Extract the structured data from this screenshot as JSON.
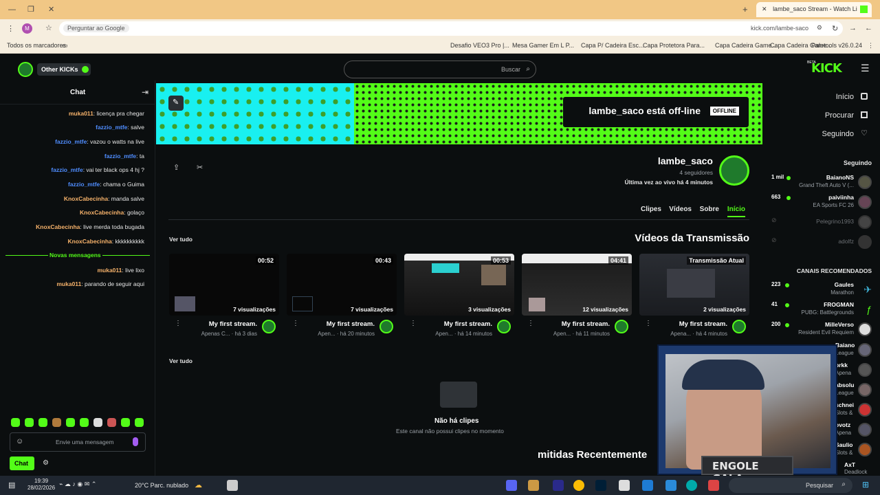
{
  "browser": {
    "tab_title": "lambe_saco Stream - Watch Li",
    "url": "kick.com/lambe-saco",
    "ask_google": "Perguntar ao Google",
    "all_bookmarks": "Todos os marcadores",
    "bookmarks": [
      "Paletools v26.0.24",
      "Capa Cadeira Game...",
      "Capa Cadeira Game...",
      "Capa Protetora Para...",
      "Capa P/ Cadeira Esc...",
      "Mesa Gamer Em L P...",
      "Desafio VEO3 Pro |..."
    ],
    "profile_initial": "M"
  },
  "header": {
    "logo": "KICK",
    "logo_badge": "BETA",
    "search_placeholder": "Buscar",
    "other_kicks": "Other KICKs"
  },
  "nav": {
    "items": [
      "Início",
      "Procurar",
      "Seguindo"
    ]
  },
  "following": {
    "title": "Seguindo",
    "channels": [
      {
        "name": "BaianoNS",
        "game": "Grand Theft Auto V (...",
        "viewers": "1 mil",
        "live": true
      },
      {
        "name": "paiviinha",
        "game": "EA Sports FC 26",
        "viewers": "663",
        "live": true
      },
      {
        "name": "Pelegrino1993",
        "game": "",
        "viewers": "",
        "live": false
      },
      {
        "name": "adolfz",
        "game": "",
        "viewers": "",
        "live": false
      }
    ]
  },
  "recommended": {
    "title": "CANAIS RECOMENDADOS",
    "channels": [
      {
        "name": "Gaules",
        "game": "Marathon",
        "viewers": "223"
      },
      {
        "name": "FROGMAN",
        "game": "PUBG: Battlegrounds",
        "viewers": "41"
      },
      {
        "name": "MilleVerso",
        "game": "Resident Evil Requiem",
        "viewers": "200"
      },
      {
        "name": "Baiano",
        "game": "League",
        "viewers": ""
      },
      {
        "name": "brkk",
        "game": "Apena",
        "viewers": ""
      },
      {
        "name": "absolu",
        "game": "League",
        "viewers": ""
      },
      {
        "name": "schnei",
        "game": "Slots &",
        "viewers": ""
      },
      {
        "name": "ovotz",
        "game": "Apena",
        "viewers": ""
      },
      {
        "name": "Saulio",
        "game": "Slots &",
        "viewers": ""
      },
      {
        "name": "AxT",
        "game": "Deadlock",
        "viewers": ""
      }
    ]
  },
  "banner": {
    "offline_badge": "OFFLINE",
    "offline_text": "lambe_saco está off-line"
  },
  "channel": {
    "name": "lambe_saco",
    "followers": "4 seguidores",
    "last_live": "Última vez ao vivo há 4 minutos",
    "tabs": [
      "Início",
      "Sobre",
      "Vídeos",
      "Clipes"
    ]
  },
  "videos": {
    "section_title": "Vídeos da Transmissão",
    "see_all": "Ver tudo",
    "items": [
      {
        "badge": "Transmissão Atual",
        "views": "2 visualizações",
        "title": "My first stream.",
        "meta": "Apena... · há 4 minutos"
      },
      {
        "badge": "04:41",
        "views": "12 visualizações",
        "title": "My first stream.",
        "meta": "Apen... · há 11 minutos"
      },
      {
        "badge": "00:53",
        "views": "3 visualizações",
        "title": "My first stream.",
        "meta": "Apen... · há 14 minutos"
      },
      {
        "badge": "00:43",
        "views": "7 visualizações",
        "title": "My first stream.",
        "meta": "Apen... · há 20 minutos"
      },
      {
        "badge": "00:52",
        "views": "7 visualizações",
        "title": "My first stream.",
        "meta": "Apenas C... · há 3 dias"
      }
    ]
  },
  "clips": {
    "see_all": "Ver tudo",
    "empty_title": "Não há clipes",
    "empty_sub": "Este canal não possui clipes no momento"
  },
  "recent": {
    "title_partial": "mitidas Recentemente"
  },
  "chat": {
    "title": "Chat",
    "messages": [
      {
        "user": "muka011",
        "text": "licença pra chegar",
        "color": "#f6b26b"
      },
      {
        "user": "fazzio_mtfe",
        "text": "salve",
        "color": "#4f8dff"
      },
      {
        "user": "fazzio_mtfe",
        "text": "vazou o watts na live",
        "color": "#4f8dff"
      },
      {
        "user": "fazzio_mtfe",
        "text": "ta",
        "color": "#4f8dff"
      },
      {
        "user": "fazzio_mtfe",
        "text": "vai ter black ops 4 hj ?",
        "color": "#4f8dff"
      },
      {
        "user": "fazzio_mtfe",
        "text": "chama o Guima",
        "color": "#4f8dff"
      },
      {
        "user": "KnoxCabecinha",
        "text": "manda salve",
        "color": "#f6b26b"
      },
      {
        "user": "KnoxCabecinha",
        "text": "golaço",
        "color": "#f6b26b"
      },
      {
        "user": "KnoxCabecinha",
        "text": "live merda toda bugada",
        "color": "#f6b26b"
      },
      {
        "user": "KnoxCabecinha",
        "text": "kkkkkkkkkk",
        "color": "#f6b26b"
      }
    ],
    "new_messages": "Novas mensagens",
    "messages_after": [
      {
        "user": "muka011",
        "text": "live lixo",
        "color": "#f6b26b"
      },
      {
        "user": "muka011",
        "text": "parando de seguir aqui",
        "color": "#f6b26b"
      }
    ],
    "input_placeholder": "Envie uma mensagem",
    "send_button": "Chat"
  },
  "webcam": {
    "overlay_text": "ENGOLE GALA"
  },
  "taskbar": {
    "weather": "20°C  Parc. nublado",
    "time": "19:39",
    "date": "28/02/2026",
    "search": "Pesquisar"
  }
}
